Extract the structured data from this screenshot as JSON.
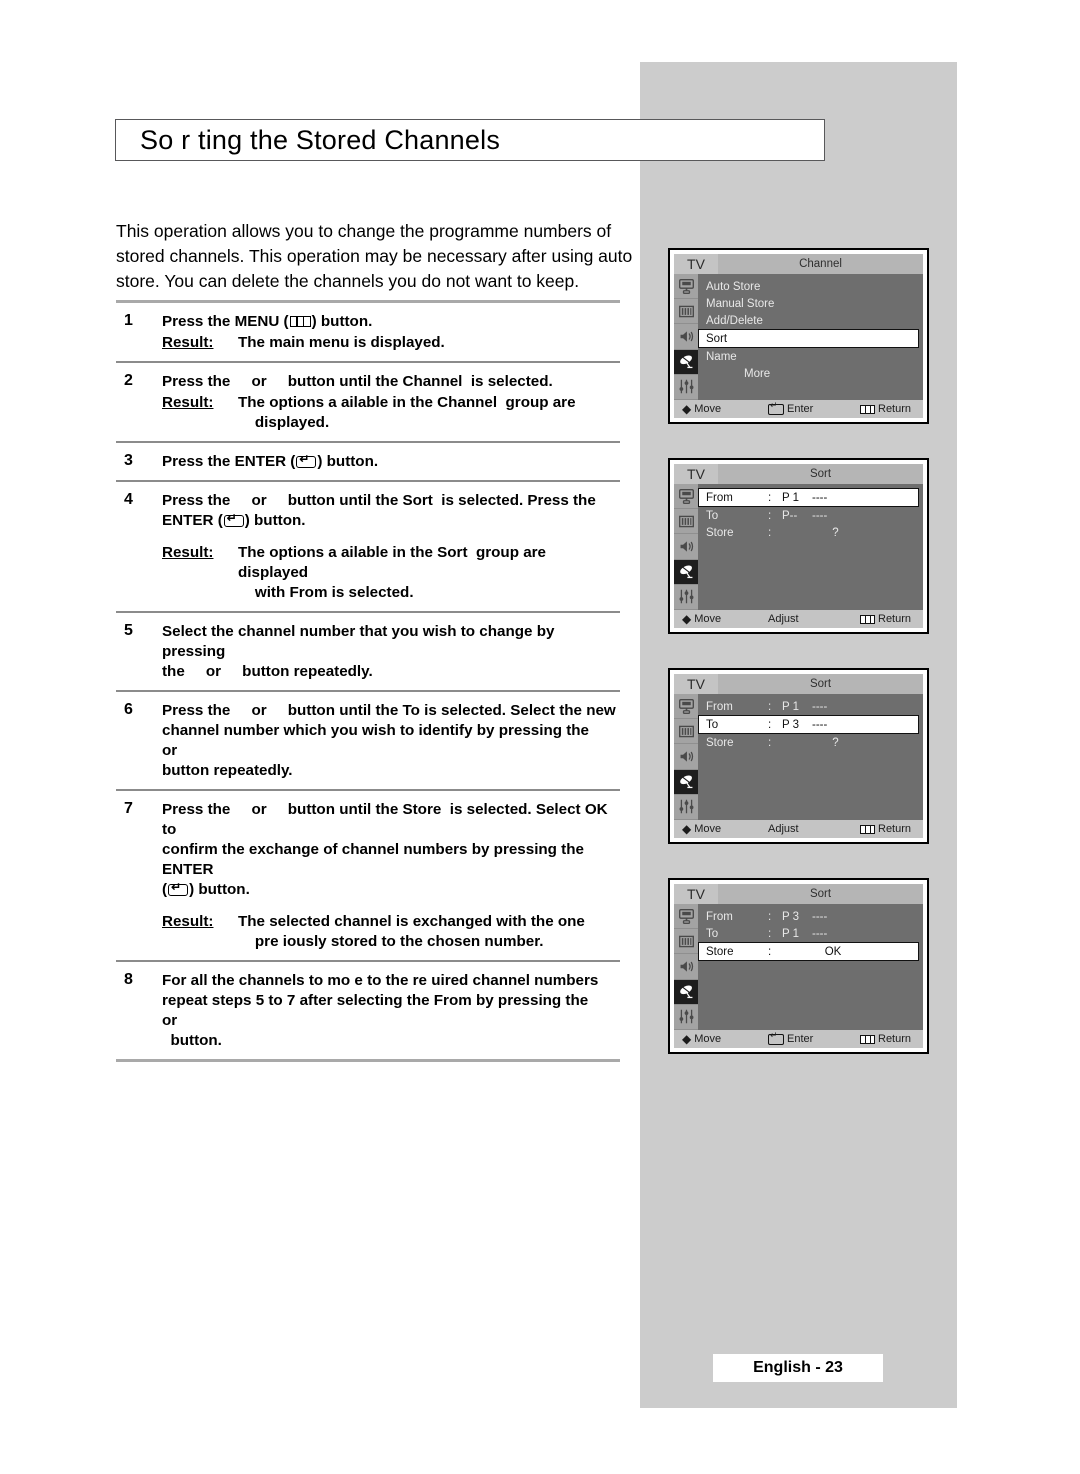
{
  "page": {
    "title": "So r ting the Stored Channels",
    "footer": "English - 23",
    "intro": "This operation allows you to change the programme numbers of\nstored channels. This operation may be necessary after using auto\nstore. You can delete the channels you do not want to keep."
  },
  "steps": [
    {
      "num": "1",
      "lines": [
        "Press the MENU (",
        ") button."
      ],
      "result_label": "Result:",
      "result_text": "The main menu is displayed."
    },
    {
      "num": "2",
      "lines": [
        "Press the     or     button until the Channel  is selected."
      ],
      "result_label": "Result:",
      "result_text": "The options a ailable in the Channel  group are\n    displayed."
    },
    {
      "num": "3",
      "lines": [
        "Press the ENTER (",
        ") button."
      ]
    },
    {
      "num": "4",
      "lines": [
        "Press the     or     button until the Sort  is selected. Press the",
        "ENTER (",
        ") button."
      ],
      "result_label": "Result:",
      "result_text": "The options a ailable in the Sort  group are displayed\n    with From is selected."
    },
    {
      "num": "5",
      "lines": [
        "Select the channel number that you wish to change by pressing\nthe     or     button repeatedly."
      ]
    },
    {
      "num": "6",
      "lines": [
        "Press the     or     button until the To is selected. Select the new\nchannel number which you wish to identify by pressing the     or\nbutton repeatedly."
      ]
    },
    {
      "num": "7",
      "lines": [
        "Press the     or     button until the Store  is selected. Select OK to\nconfirm the exchange of channel numbers by pressing the ENTER",
        "(",
        ") button."
      ],
      "result_label": "Result:",
      "result_text": "The selected channel is exchanged with the one\n    pre iously stored to the chosen number."
    },
    {
      "num": "8",
      "lines": [
        "For all the channels to mo e to the re uired channel numbers\nrepeat steps 5 to 7 after selecting the From by pressing the     or\n  button."
      ]
    }
  ],
  "tv_screens": [
    {
      "tv_label": "TV",
      "title": "Channel",
      "type": "menu",
      "options": [
        {
          "label": "Auto Store",
          "highlighted": false,
          "indent": false
        },
        {
          "label": "Manual Store",
          "highlighted": false,
          "indent": false
        },
        {
          "label": "Add/Delete",
          "highlighted": false,
          "indent": false
        },
        {
          "label": "Sort",
          "highlighted": true,
          "indent": false
        },
        {
          "label": "Name",
          "highlighted": false,
          "indent": false
        },
        {
          "label": "More",
          "highlighted": false,
          "indent": true
        }
      ],
      "footer": {
        "move": "Move",
        "middle": "Enter",
        "middle_icon": "enter-icon",
        "return": "Return"
      }
    },
    {
      "tv_label": "TV",
      "title": "Sort",
      "type": "sort",
      "rows": [
        {
          "label": "From",
          "colon": ":",
          "value": "P 1",
          "dash": "----",
          "highlighted": true,
          "centered": false
        },
        {
          "label": "To",
          "colon": ":",
          "value": "P--",
          "dash": "----",
          "highlighted": false,
          "centered": false
        },
        {
          "label": "Store",
          "colon": ":",
          "value": "?",
          "dash": "",
          "highlighted": false,
          "centered": true
        }
      ],
      "footer": {
        "move": "Move",
        "middle": "Adjust",
        "middle_icon": "",
        "return": "Return"
      }
    },
    {
      "tv_label": "TV",
      "title": "Sort",
      "type": "sort",
      "rows": [
        {
          "label": "From",
          "colon": ":",
          "value": "P 1",
          "dash": "----",
          "highlighted": false,
          "centered": false
        },
        {
          "label": "To",
          "colon": ":",
          "value": "P 3",
          "dash": "----",
          "highlighted": true,
          "centered": false
        },
        {
          "label": "Store",
          "colon": ":",
          "value": "?",
          "dash": "",
          "highlighted": false,
          "centered": true
        }
      ],
      "footer": {
        "move": "Move",
        "middle": "Adjust",
        "middle_icon": "",
        "return": "Return"
      }
    },
    {
      "tv_label": "TV",
      "title": "Sort",
      "type": "sort",
      "rows": [
        {
          "label": "From",
          "colon": ":",
          "value": "P 3",
          "dash": "----",
          "highlighted": false,
          "centered": false
        },
        {
          "label": "To",
          "colon": ":",
          "value": "P 1",
          "dash": "----",
          "highlighted": false,
          "centered": false
        },
        {
          "label": "Store",
          "colon": ":",
          "value": "OK",
          "dash": "",
          "highlighted": true,
          "centered": true
        }
      ],
      "footer": {
        "move": "Move",
        "middle": "Enter",
        "middle_icon": "enter-icon",
        "return": "Return"
      }
    }
  ],
  "sidebar_icons": [
    "picture-tube-icon",
    "picture-bars-icon",
    "speaker-icon",
    "satellite-dish-icon",
    "setup-sliders-icon"
  ],
  "colors": {
    "band": "#cccccc",
    "osd_bg": "#6e6e6e",
    "osd_title": "#b5b5b5",
    "osd_selected": "#1d1d1d"
  }
}
